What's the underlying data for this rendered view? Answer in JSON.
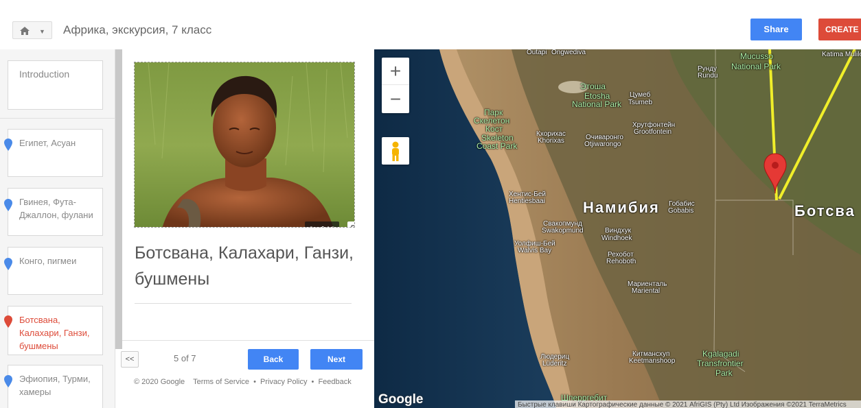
{
  "header": {
    "home_icon": "home-icon",
    "caret_icon": "chevron-down-icon",
    "title": "Африка, экскурсия, 7 класс",
    "share_label": "Share",
    "create_label": "CREATE N"
  },
  "slides": [
    {
      "label": "Introduction",
      "pin": false,
      "active": false
    },
    {
      "label": "Египет, Асуан",
      "pin": true,
      "active": false
    },
    {
      "label": "Гвинея, Фута-Джаллон, фулани",
      "pin": true,
      "active": false
    },
    {
      "label": "Конго, пигмеи",
      "pin": true,
      "active": false
    },
    {
      "label": "Ботсвана, Калахари, Ганзи, бушмены",
      "pin": true,
      "active": true
    },
    {
      "label": "Эфиопия, Турми, хамеры",
      "pin": true,
      "active": false
    }
  ],
  "detail": {
    "photo_counter": "2 of 18",
    "title": "Ботсвана, Калахари, Ганзи, бушмены",
    "prev_label": "<<",
    "page_indicator": "5 of 7",
    "back_label": "Back",
    "next_label": "Next",
    "footer": {
      "copyright": "© 2020 Google",
      "terms": "Terms of Service",
      "privacy": "Privacy Policy",
      "feedback": "Feedback",
      "separator": "•"
    }
  },
  "map": {
    "zoom_in": "+",
    "zoom_out": "−",
    "logo": "Google",
    "attribution": "Быстрые клавиши   Картографические данные © 2021 AfriGIS (Pty) Ltd Изображения ©2021 TerraMetrics",
    "labels": {
      "outapi": "Outapi",
      "ongwediva": "Ongwediva",
      "mucusso": "Mucusso",
      "mucusso_park": "National Park",
      "katima": "Katima Mulilo",
      "rundu_ru": "Рунду",
      "rundu": "Rundu",
      "etosha_ru": "Этоша",
      "etosha_en": "Etosha",
      "etosha_park": "National Park",
      "tsumeb_ru": "Цумеб",
      "tsumeb": "Tsumeb",
      "skeleton_1": "Парк",
      "skeleton_2": "Скелетон",
      "skeleton_3": "Кост",
      "skeleton_4": "Skeleton",
      "skeleton_5": "Coast Park",
      "khorixas_ru": "Кхорихас",
      "khorixas": "Khorixas",
      "otjiwarongo_ru": "Очиваронго",
      "otjiwarongo": "Otjiwarongo",
      "grootfontein_ru": "Хрутфонтейн",
      "grootfontein": "Grootfontein",
      "henties_ru": "Хентис-Бей",
      "henties": "Hentiesbaai",
      "namibia": "Намибия",
      "gobabis_ru": "Гобабис",
      "gobabis": "Gobabis",
      "botswana": "Ботсва",
      "swakop_ru": "Свакопмунд",
      "swakop": "Swakopmund",
      "windhoek_ru": "Виндхук",
      "windhoek": "Windhoek",
      "walvis_ru": "Уолфиш-Бей",
      "walvis": "Walvis Bay",
      "rehoboth_ru": "Рехобот",
      "rehoboth": "Rehoboth",
      "mariental_ru": "Мариенталь",
      "mariental": "Mariental",
      "luderitz_ru": "Людериц",
      "luderitz": "Lüderitz",
      "keetman_ru": "Китмансхуп",
      "keetman": "Keetmanshoop",
      "kgalagadi_1": "Kgalagadi",
      "kgalagadi_2": "Transfrontier",
      "kgalagadi_3": "Park",
      "sperrgebiet": "Шперргебит"
    }
  }
}
